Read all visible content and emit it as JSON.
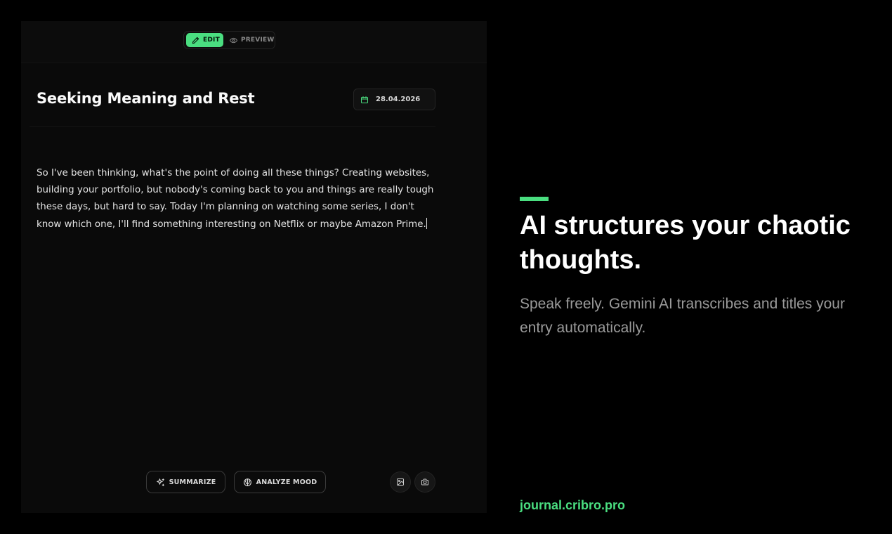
{
  "editor": {
    "mode_toggle": {
      "edit_label": "EDIT",
      "preview_label": "PREVIEW",
      "active": "edit"
    },
    "entry": {
      "title": "Seeking Meaning and Rest",
      "date": "28.04.2026",
      "body": "So I've been thinking, what's the point of doing all these things? Creating websites, building your portfolio, but nobody's coming back to you and things are really tough these days, but hard to say. Today I'm planning on watching some series, I don't know which one, I'll find something interesting on Netflix or maybe Amazon Prime."
    },
    "actions": {
      "summarize_label": "SUMMARIZE",
      "analyze_mood_label": "ANALYZE MOOD",
      "attach_image_icon": "image-icon",
      "camera_icon": "camera-icon"
    }
  },
  "promo": {
    "headline": "AI structures your chaotic thoughts.",
    "subline": "Speak freely. Gemini AI transcribes and titles your entry automatically.",
    "site": "journal.cribro.pro"
  },
  "colors": {
    "accent": "#4ade80",
    "background": "#000000",
    "panel": "#0a0a0a"
  }
}
